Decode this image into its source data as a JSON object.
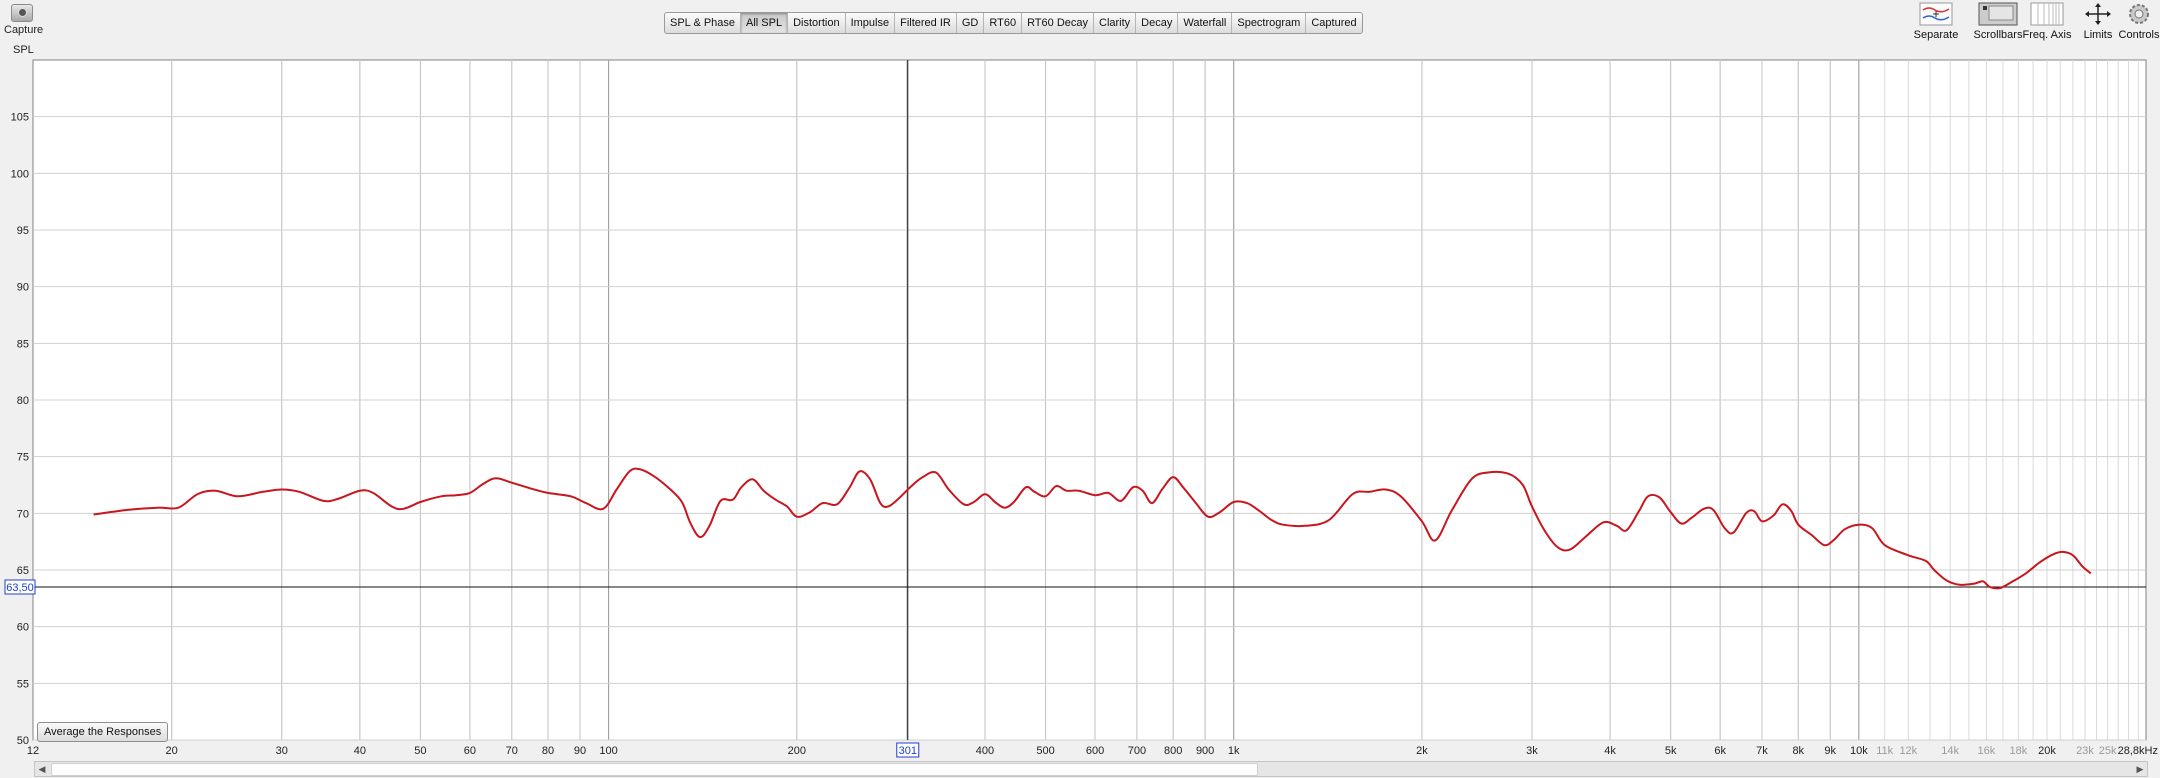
{
  "toolbar": {
    "capture_label": "Capture",
    "tabs": [
      "SPL & Phase",
      "All SPL",
      "Distortion",
      "Impulse",
      "Filtered IR",
      "GD",
      "RT60",
      "RT60 Decay",
      "Clarity",
      "Decay",
      "Waterfall",
      "Spectrogram",
      "Captured"
    ],
    "active_tab": "All SPL",
    "right_tools": [
      {
        "label": "Separate",
        "icon": "separate-icon"
      },
      {
        "label": "Scrollbars",
        "icon": "scrollbars-icon"
      },
      {
        "label": "Freq. Axis",
        "icon": "freq-axis-icon"
      },
      {
        "label": "Limits",
        "icon": "limits-icon"
      },
      {
        "label": "Controls",
        "icon": "controls-icon"
      }
    ]
  },
  "axis": {
    "y_title": "SPL",
    "cursor_y_label": "63,50",
    "cursor_x_label": "301"
  },
  "average_button_label": "Average the Responses",
  "colors": {
    "trace": "#c8161e",
    "grid": "#c8c8c8",
    "grid_major": "#9a9a9a",
    "cursor_label": "#1f3fd0"
  },
  "chart_data": {
    "type": "line",
    "x_scale": "log",
    "xlim": [
      12,
      28800
    ],
    "ylim": [
      50,
      110
    ],
    "ylabel": "SPL",
    "grid": true,
    "y_ticks": [
      "50",
      "55",
      "60",
      "65",
      "70",
      "75",
      "80",
      "85",
      "90",
      "95",
      "100",
      "105"
    ],
    "x_ticks": [
      {
        "label": "12",
        "f": 12,
        "faint": false
      },
      {
        "label": "20",
        "f": 20,
        "faint": false
      },
      {
        "label": "30",
        "f": 30,
        "faint": false
      },
      {
        "label": "40",
        "f": 40,
        "faint": false
      },
      {
        "label": "50",
        "f": 50,
        "faint": false
      },
      {
        "label": "60",
        "f": 60,
        "faint": false
      },
      {
        "label": "70",
        "f": 70,
        "faint": false
      },
      {
        "label": "80",
        "f": 80,
        "faint": false
      },
      {
        "label": "90",
        "f": 90,
        "faint": false
      },
      {
        "label": "100",
        "f": 100,
        "faint": false
      },
      {
        "label": "200",
        "f": 200,
        "faint": false
      },
      {
        "label": "400",
        "f": 400,
        "faint": false
      },
      {
        "label": "500",
        "f": 500,
        "faint": false
      },
      {
        "label": "600",
        "f": 600,
        "faint": false
      },
      {
        "label": "700",
        "f": 700,
        "faint": false
      },
      {
        "label": "800",
        "f": 800,
        "faint": false
      },
      {
        "label": "900",
        "f": 900,
        "faint": false
      },
      {
        "label": "1k",
        "f": 1000,
        "faint": false
      },
      {
        "label": "2k",
        "f": 2000,
        "faint": false
      },
      {
        "label": "3k",
        "f": 3000,
        "faint": false
      },
      {
        "label": "4k",
        "f": 4000,
        "faint": false
      },
      {
        "label": "5k",
        "f": 5000,
        "faint": false
      },
      {
        "label": "6k",
        "f": 6000,
        "faint": false
      },
      {
        "label": "7k",
        "f": 7000,
        "faint": false
      },
      {
        "label": "8k",
        "f": 8000,
        "faint": false
      },
      {
        "label": "9k",
        "f": 9000,
        "faint": false
      },
      {
        "label": "10k",
        "f": 10000,
        "faint": false
      },
      {
        "label": "11k",
        "f": 11000,
        "faint": true
      },
      {
        "label": "12k",
        "f": 12000,
        "faint": true
      },
      {
        "label": "14k",
        "f": 14000,
        "faint": true
      },
      {
        "label": "16k",
        "f": 16000,
        "faint": true
      },
      {
        "label": "18k",
        "f": 18000,
        "faint": true
      },
      {
        "label": "20k",
        "f": 20000,
        "faint": false
      },
      {
        "label": "23k",
        "f": 23000,
        "faint": true
      },
      {
        "label": "25k",
        "f": 25000,
        "faint": true
      },
      {
        "label": "28,8kHz",
        "f": 28800,
        "faint": false
      }
    ],
    "cursor": {
      "x": 301,
      "y": 63.5
    },
    "series": [
      {
        "color": "#c8161e",
        "points": [
          [
            15,
            69.9
          ],
          [
            17,
            70.3
          ],
          [
            19,
            70.5
          ],
          [
            20.5,
            70.5
          ],
          [
            22,
            71.7
          ],
          [
            23.5,
            72.0
          ],
          [
            25.5,
            71.5
          ],
          [
            28,
            71.9
          ],
          [
            30,
            72.1
          ],
          [
            32,
            71.9
          ],
          [
            35,
            71.1
          ],
          [
            37,
            71.3
          ],
          [
            40,
            72.0
          ],
          [
            42,
            71.8
          ],
          [
            45,
            70.6
          ],
          [
            47,
            70.4
          ],
          [
            50,
            71.0
          ],
          [
            54,
            71.5
          ],
          [
            57,
            71.6
          ],
          [
            60,
            71.8
          ],
          [
            63,
            72.6
          ],
          [
            66,
            73.1
          ],
          [
            70,
            72.7
          ],
          [
            75,
            72.2
          ],
          [
            80,
            71.8
          ],
          [
            87,
            71.5
          ],
          [
            92,
            70.9
          ],
          [
            98,
            70.4
          ],
          [
            103,
            72.1
          ],
          [
            108,
            73.7
          ],
          [
            112,
            73.9
          ],
          [
            118,
            73.3
          ],
          [
            125,
            72.2
          ],
          [
            131,
            71.0
          ],
          [
            135,
            69.2
          ],
          [
            140,
            67.9
          ],
          [
            145,
            68.9
          ],
          [
            151,
            71.1
          ],
          [
            158,
            71.2
          ],
          [
            163,
            72.3
          ],
          [
            170,
            73.0
          ],
          [
            177,
            72.0
          ],
          [
            185,
            71.2
          ],
          [
            193,
            70.6
          ],
          [
            200,
            69.7
          ],
          [
            210,
            70.1
          ],
          [
            220,
            70.9
          ],
          [
            232,
            70.8
          ],
          [
            243,
            72.3
          ],
          [
            252,
            73.7
          ],
          [
            262,
            73.0
          ],
          [
            272,
            70.9
          ],
          [
            280,
            70.6
          ],
          [
            291,
            71.3
          ],
          [
            305,
            72.4
          ],
          [
            318,
            73.2
          ],
          [
            334,
            73.6
          ],
          [
            350,
            72.1
          ],
          [
            370,
            70.8
          ],
          [
            384,
            71.0
          ],
          [
            400,
            71.7
          ],
          [
            415,
            71.0
          ],
          [
            430,
            70.5
          ],
          [
            445,
            71.0
          ],
          [
            465,
            72.3
          ],
          [
            480,
            71.9
          ],
          [
            500,
            71.5
          ],
          [
            520,
            72.4
          ],
          [
            540,
            72.0
          ],
          [
            565,
            72.0
          ],
          [
            600,
            71.6
          ],
          [
            630,
            71.8
          ],
          [
            660,
            71.1
          ],
          [
            690,
            72.3
          ],
          [
            715,
            72.0
          ],
          [
            740,
            70.9
          ],
          [
            770,
            72.2
          ],
          [
            800,
            73.2
          ],
          [
            830,
            72.3
          ],
          [
            870,
            70.9
          ],
          [
            910,
            69.7
          ],
          [
            950,
            70.1
          ],
          [
            1000,
            71.0
          ],
          [
            1050,
            70.9
          ],
          [
            1100,
            70.2
          ],
          [
            1150,
            69.4
          ],
          [
            1200,
            69.0
          ],
          [
            1300,
            68.9
          ],
          [
            1420,
            69.4
          ],
          [
            1550,
            71.7
          ],
          [
            1650,
            71.9
          ],
          [
            1750,
            72.1
          ],
          [
            1850,
            71.5
          ],
          [
            2000,
            69.3
          ],
          [
            2100,
            67.6
          ],
          [
            2230,
            70.2
          ],
          [
            2400,
            73.0
          ],
          [
            2550,
            73.6
          ],
          [
            2750,
            73.5
          ],
          [
            2900,
            72.5
          ],
          [
            3000,
            70.6
          ],
          [
            3150,
            68.4
          ],
          [
            3300,
            67.0
          ],
          [
            3450,
            66.8
          ],
          [
            3650,
            67.9
          ],
          [
            3900,
            69.2
          ],
          [
            4100,
            68.9
          ],
          [
            4250,
            68.5
          ],
          [
            4450,
            70.2
          ],
          [
            4600,
            71.5
          ],
          [
            4800,
            71.4
          ],
          [
            5000,
            70.1
          ],
          [
            5200,
            69.1
          ],
          [
            5400,
            69.6
          ],
          [
            5650,
            70.4
          ],
          [
            5850,
            70.3
          ],
          [
            6100,
            68.7
          ],
          [
            6300,
            68.3
          ],
          [
            6600,
            70.0
          ],
          [
            6800,
            70.2
          ],
          [
            7000,
            69.3
          ],
          [
            7300,
            69.8
          ],
          [
            7550,
            70.8
          ],
          [
            7800,
            70.2
          ],
          [
            8000,
            69.0
          ],
          [
            8400,
            68.1
          ],
          [
            8800,
            67.2
          ],
          [
            9100,
            67.6
          ],
          [
            9500,
            68.6
          ],
          [
            10000,
            69.0
          ],
          [
            10500,
            68.7
          ],
          [
            11000,
            67.2
          ],
          [
            12000,
            66.3
          ],
          [
            12800,
            65.8
          ],
          [
            13200,
            65.0
          ],
          [
            13800,
            64.1
          ],
          [
            14500,
            63.7
          ],
          [
            15300,
            63.8
          ],
          [
            15800,
            64.0
          ],
          [
            16200,
            63.5
          ],
          [
            16800,
            63.4
          ],
          [
            17500,
            63.9
          ],
          [
            18500,
            64.7
          ],
          [
            19500,
            65.7
          ],
          [
            20500,
            66.4
          ],
          [
            21200,
            66.6
          ],
          [
            22000,
            66.3
          ],
          [
            22800,
            65.3
          ],
          [
            23500,
            64.7
          ]
        ]
      }
    ]
  }
}
